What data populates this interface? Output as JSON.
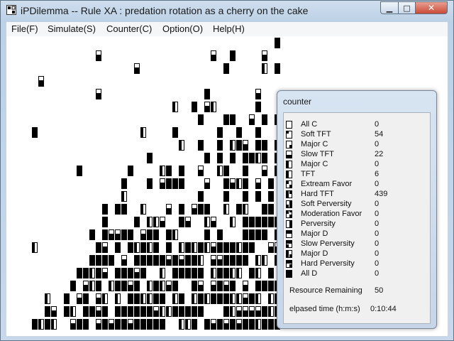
{
  "window": {
    "title": "iPDilemma -- Rule XA : predation rotation as a cherry on the cake",
    "minimize_glyph": "▁",
    "maximize_glyph": "□",
    "close_glyph": "✕"
  },
  "menu": {
    "items": [
      {
        "label": "File(F)"
      },
      {
        "label": "Simulate(S)"
      },
      {
        "label": "Counter(C)"
      },
      {
        "label": "Option(O)"
      },
      {
        "label": "Help(H)"
      }
    ]
  },
  "counter": {
    "title": "counter",
    "strategies": [
      {
        "name": "All C",
        "value": "0",
        "icon": "all-c"
      },
      {
        "name": "Soft TFT",
        "value": "54",
        "icon": "soft-tft"
      },
      {
        "name": "Major C",
        "value": "0",
        "icon": "major-c"
      },
      {
        "name": "Slow TFT",
        "value": "22",
        "icon": "slow-tft"
      },
      {
        "name": "Major C",
        "value": "0",
        "icon": "major-c-2"
      },
      {
        "name": "TFT",
        "value": "6",
        "icon": "tft"
      },
      {
        "name": "Extream Favor",
        "value": "0",
        "icon": "extream-favor"
      },
      {
        "name": "Hard TFT",
        "value": "439",
        "icon": "hard-tft"
      },
      {
        "name": "Soft Perversity",
        "value": "0",
        "icon": "soft-perversity"
      },
      {
        "name": "Moderation Favor",
        "value": "0",
        "icon": "moderation-favor"
      },
      {
        "name": "Perversity",
        "value": "0",
        "icon": "perversity"
      },
      {
        "name": "Major D",
        "value": "0",
        "icon": "major-d"
      },
      {
        "name": "Slow Perversity",
        "value": "0",
        "icon": "slow-perversity"
      },
      {
        "name": "Major D",
        "value": "0",
        "icon": "major-d-2"
      },
      {
        "name": "Hard Perversity",
        "value": "0",
        "icon": "hard-perversity"
      },
      {
        "name": "All D",
        "value": "0",
        "icon": "all-d"
      }
    ],
    "resource_label": "Resource Remaining",
    "resource_value": "50",
    "time_label": "elpased time (h:m:s)",
    "time_value": "0:10:44"
  }
}
